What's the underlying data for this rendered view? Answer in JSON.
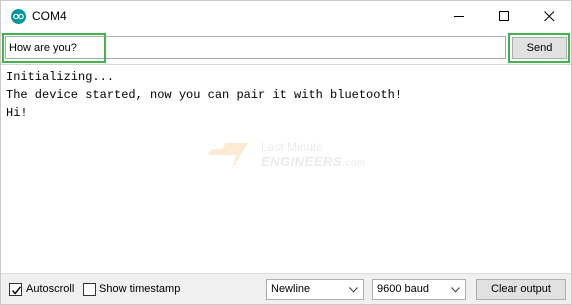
{
  "window": {
    "title": "COM4",
    "controls": [
      "minimize",
      "maximize",
      "close"
    ]
  },
  "input": {
    "value": "How are you?",
    "send_label": "Send",
    "highlight_color": "#3fb54c"
  },
  "output": {
    "lines": [
      "Initializing...",
      "The device started, now you can pair it with bluetooth!",
      "Hi!"
    ]
  },
  "watermark": {
    "line1": "Last Minute",
    "line2": "ENGINEERS",
    "suffix": ".com"
  },
  "bottom_bar": {
    "autoscroll": {
      "label": "Autoscroll",
      "checked": true
    },
    "show_timestamp": {
      "label": "Show timestamp",
      "checked": false
    },
    "line_ending": {
      "selected": "Newline"
    },
    "baud_rate": {
      "selected": "9600 baud"
    },
    "clear_label": "Clear output"
  },
  "icons": {
    "app": "arduino-icon",
    "minimize": "minimize-icon",
    "maximize": "maximize-icon",
    "close": "close-icon",
    "dropdown": "chevron-down-icon",
    "check": "checkmark-icon"
  }
}
